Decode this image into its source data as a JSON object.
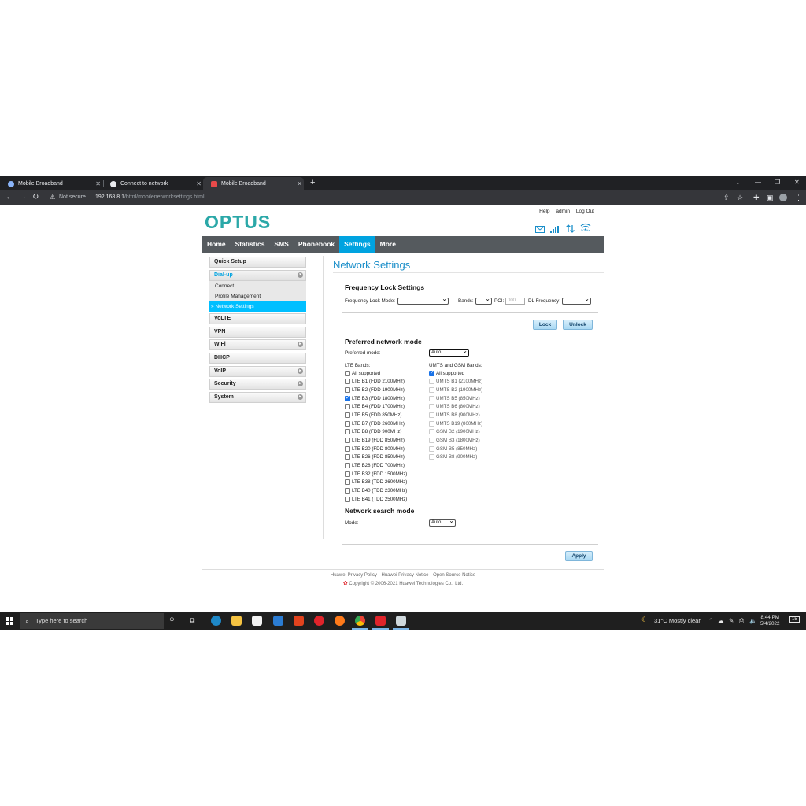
{
  "browser": {
    "tabs": [
      {
        "title": "Mobile Broadband",
        "active": false
      },
      {
        "title": "Connect to network",
        "active": false
      },
      {
        "title": "Mobile Broadband",
        "active": true
      }
    ],
    "new_tab": "+",
    "security_label": "Not secure",
    "url_host": "192.168.8.1",
    "url_path": "/html/mobilenetworksettings.html"
  },
  "router": {
    "logo": "OPTUS",
    "top_links": {
      "help": "Help",
      "admin": "admin",
      "logout": "Log Out"
    },
    "wifi_band": "5G Hz",
    "nav": [
      "Home",
      "Statistics",
      "SMS",
      "Phonebook",
      "Settings",
      "More"
    ],
    "active_nav": "Settings",
    "sidebar": {
      "quick_setup": "Quick Setup",
      "dialup": "Dial-up",
      "dialup_sub": [
        "Connect",
        "Profile Management",
        "Network Settings"
      ],
      "active_sub_prefix": "»",
      "items": [
        "VoLTE",
        "VPN",
        "WiFi",
        "DHCP",
        "VoIP",
        "Security",
        "System"
      ]
    },
    "page_title": "Network Settings",
    "freq_lock": {
      "heading": "Frequency Lock Settings",
      "mode_label": "Frequency Lock Mode:",
      "mode_value": "",
      "bands_label": "Bands:",
      "bands_value": "",
      "pci_label": "PCI:",
      "pci_placeholder": "000",
      "dl_label": "DL Frequency:",
      "dl_value": "",
      "lock_btn": "Lock",
      "unlock_btn": "Unlock"
    },
    "preferred": {
      "heading": "Preferred network mode",
      "mode_label": "Preferred mode:",
      "mode_value": "Auto",
      "lte_label": "LTE Bands:",
      "umts_label": "UMTS and GSM Bands:",
      "lte_bands": [
        {
          "label": "All supported",
          "checked": false
        },
        {
          "label": "LTE B1 (FDD 2100MHz)",
          "checked": false
        },
        {
          "label": "LTE B2 (FDD 1900MHz)",
          "checked": false
        },
        {
          "label": "LTE B3 (FDD 1800MHz)",
          "checked": true
        },
        {
          "label": "LTE B4 (FDD 1700MHz)",
          "checked": false
        },
        {
          "label": "LTE B5 (FDD 850MHz)",
          "checked": false
        },
        {
          "label": "LTE B7 (FDD 2600MHz)",
          "checked": false
        },
        {
          "label": "LTE B8 (FDD 900MHz)",
          "checked": false
        },
        {
          "label": "LTE B19 (FDD 850MHz)",
          "checked": false
        },
        {
          "label": "LTE B20 (FDD 800MHz)",
          "checked": false
        },
        {
          "label": "LTE B26 (FDD 850MHz)",
          "checked": false
        },
        {
          "label": "LTE B28 (FDD 700MHz)",
          "checked": false
        },
        {
          "label": "LTE B32 (FDD 1500MHz)",
          "checked": false
        },
        {
          "label": "LTE B38 (TDD 2600MHz)",
          "checked": false
        },
        {
          "label": "LTE B40 (TDD 2300MHz)",
          "checked": false
        },
        {
          "label": "LTE B41 (TDD 2500MHz)",
          "checked": false
        }
      ],
      "umts_bands": [
        {
          "label": "All supported",
          "checked": true,
          "disabled": false
        },
        {
          "label": "UMTS B1 (2100MHz)",
          "checked": false,
          "disabled": true
        },
        {
          "label": "UMTS B2 (1900MHz)",
          "checked": false,
          "disabled": true
        },
        {
          "label": "UMTS B5 (850MHz)",
          "checked": false,
          "disabled": true
        },
        {
          "label": "UMTS B6 (800MHz)",
          "checked": false,
          "disabled": true
        },
        {
          "label": "UMTS B8 (900MHz)",
          "checked": false,
          "disabled": true
        },
        {
          "label": "UMTS B19 (800MHz)",
          "checked": false,
          "disabled": true
        },
        {
          "label": "GSM B2 (1900MHz)",
          "checked": false,
          "disabled": true
        },
        {
          "label": "GSM B3 (1800MHz)",
          "checked": false,
          "disabled": true
        },
        {
          "label": "GSM B5 (850MHz)",
          "checked": false,
          "disabled": true
        },
        {
          "label": "GSM B8 (900MHz)",
          "checked": false,
          "disabled": true
        }
      ]
    },
    "search": {
      "heading": "Network search mode",
      "mode_label": "Mode:",
      "mode_value": "Auto",
      "apply_btn": "Apply"
    },
    "footer": {
      "links": [
        "Huawei Privacy Policy",
        "Huawei Privacy Notice",
        "Open Source Notice"
      ],
      "copyright": "Copyright © 2006-2021 Huawei Technologies Co., Ltd."
    }
  },
  "taskbar": {
    "search_placeholder": "Type here to search",
    "weather": "31°C  Mostly clear",
    "time": "8:44 PM",
    "date": "5/4/2022",
    "notifications": "15"
  },
  "colors": {
    "brand": "#2ba8a8",
    "nav_bg": "#555a5e",
    "accent": "#00a3e0",
    "title": "#1a8ec9"
  }
}
